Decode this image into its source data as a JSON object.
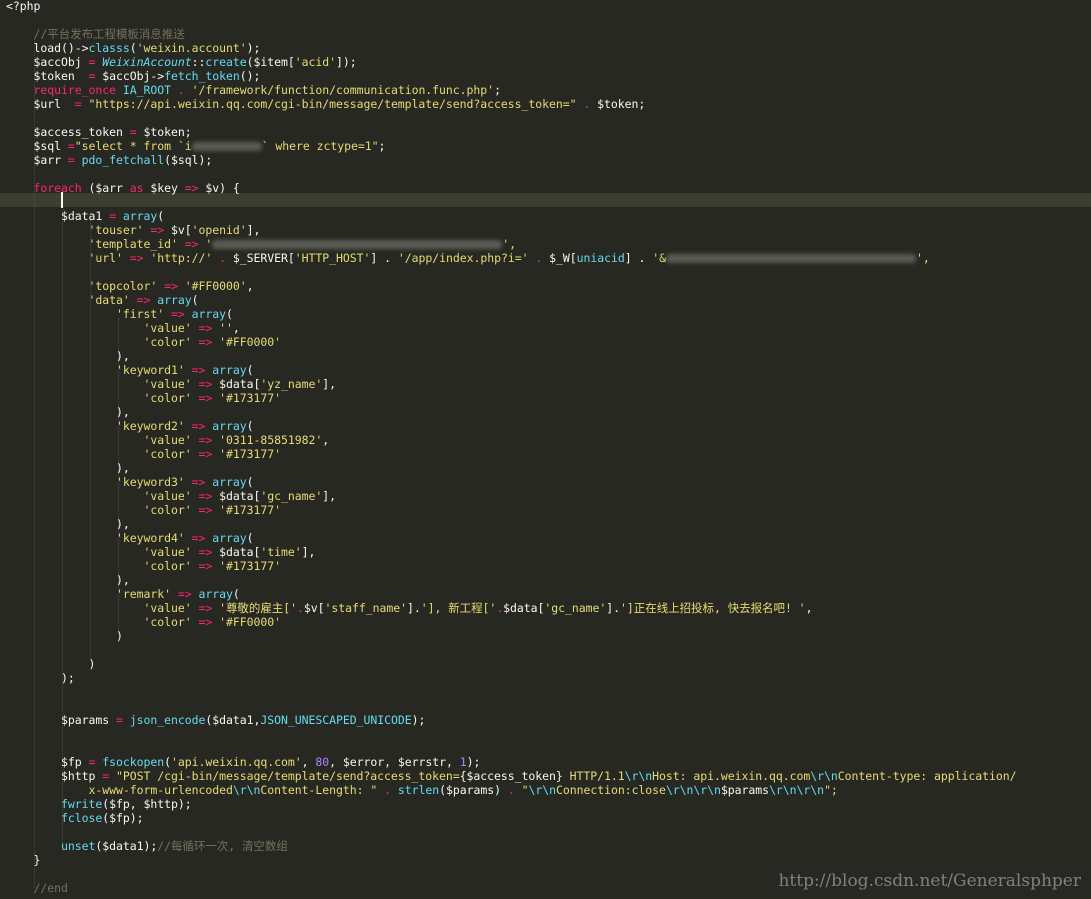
{
  "colors": {
    "background": "#272822",
    "keyword": "#f92672",
    "string": "#e6db74",
    "function": "#66d9ef",
    "comment": "#75715e",
    "number": "#ae81ff",
    "text": "#f8f8f2"
  },
  "watermark": "http://blog.csdn.net/Generalsphper",
  "code_lines": [
    {
      "tokens": [
        [
          "<?php",
          "plain"
        ]
      ]
    },
    {
      "tokens": []
    },
    {
      "tokens": [
        [
          "    //平台发布工程模板消息推送",
          "cm"
        ]
      ]
    },
    {
      "tokens": [
        [
          "    load()->",
          "plain"
        ],
        [
          "classs",
          "fn"
        ],
        [
          "(",
          "plain"
        ],
        [
          "'weixin.account'",
          "str"
        ],
        [
          ");",
          "plain"
        ]
      ]
    },
    {
      "tokens": [
        [
          "    $accObj ",
          "var"
        ],
        [
          "= ",
          "kw"
        ],
        [
          "WeixinAccount",
          "cls"
        ],
        [
          "::",
          "plain"
        ],
        [
          "create",
          "fn"
        ],
        [
          "($item[",
          "plain"
        ],
        [
          "'acid'",
          "str"
        ],
        [
          "]);",
          "plain"
        ]
      ]
    },
    {
      "tokens": [
        [
          "    $token  ",
          "var"
        ],
        [
          "= ",
          "kw"
        ],
        [
          "$accObj->",
          "plain"
        ],
        [
          "fetch_token",
          "fn"
        ],
        [
          "();",
          "plain"
        ]
      ]
    },
    {
      "tokens": [
        [
          "    require_once ",
          "kw"
        ],
        [
          "IA_ROOT ",
          "cst"
        ],
        [
          ". ",
          "kw"
        ],
        [
          "'/framework/function/communication.func.php'",
          "str"
        ],
        [
          ";",
          "plain"
        ]
      ]
    },
    {
      "tokens": [
        [
          "    $url  ",
          "var"
        ],
        [
          "= ",
          "kw"
        ],
        [
          "\"https://api.weixin.qq.com/cgi-bin/message/template/send?access_token=\"",
          "str"
        ],
        [
          " . ",
          "kw"
        ],
        [
          "$token;",
          "plain"
        ]
      ]
    },
    {
      "tokens": []
    },
    {
      "tokens": [
        [
          "    $access_token ",
          "var"
        ],
        [
          "= ",
          "kw"
        ],
        [
          "$token;",
          "plain"
        ]
      ]
    },
    {
      "tokens": [
        [
          "    $sql ",
          "var"
        ],
        [
          "=",
          "kw"
        ],
        [
          "\"select * from `i",
          "str"
        ],
        [
          "#blur:70",
          "blur"
        ],
        [
          "` where zctype=1\"",
          "str"
        ],
        [
          ";",
          "plain"
        ]
      ]
    },
    {
      "tokens": [
        [
          "    $arr ",
          "var"
        ],
        [
          "= ",
          "kw"
        ],
        [
          "pdo_fetchall",
          "fn"
        ],
        [
          "($sql);",
          "plain"
        ]
      ]
    },
    {
      "tokens": []
    },
    {
      "tokens": [
        [
          "    foreach ",
          "kw"
        ],
        [
          "($arr ",
          "plain"
        ],
        [
          "as ",
          "kw"
        ],
        [
          "$key ",
          "plain"
        ],
        [
          "=> ",
          "kw"
        ],
        [
          "$v) {",
          "plain"
        ]
      ]
    },
    {
      "tokens": []
    },
    {
      "tokens": [
        [
          "        $data1 ",
          "var"
        ],
        [
          "= ",
          "kw"
        ],
        [
          "array",
          "fn"
        ],
        [
          "(",
          "plain"
        ]
      ]
    },
    {
      "tokens": [
        [
          "            'touser'",
          "str"
        ],
        [
          " => ",
          "kw"
        ],
        [
          "$v[",
          "plain"
        ],
        [
          "'openid'",
          "str"
        ],
        [
          "],",
          "plain"
        ]
      ]
    },
    {
      "tokens": [
        [
          "            'template_id'",
          "str"
        ],
        [
          " => ",
          "kw"
        ],
        [
          "'",
          "str"
        ],
        [
          "#blur:290",
          "blur"
        ],
        [
          "',",
          "str"
        ]
      ]
    },
    {
      "tokens": [
        [
          "            'url'",
          "str"
        ],
        [
          " => ",
          "kw"
        ],
        [
          "'http://'",
          "str"
        ],
        [
          " . ",
          "kw"
        ],
        [
          "$_SERVER[",
          "plain"
        ],
        [
          "'HTTP_HOST'",
          "str"
        ],
        [
          "] . ",
          "plain"
        ],
        [
          "'/app/index.php?i='",
          "str"
        ],
        [
          " . ",
          "kw"
        ],
        [
          "$_W[",
          "plain"
        ],
        [
          "uniacid",
          "fn"
        ],
        [
          "] . ",
          "plain"
        ],
        [
          "'&",
          "str"
        ],
        [
          "#blur:250",
          "blur"
        ],
        [
          "',",
          "str"
        ]
      ]
    },
    {
      "tokens": []
    },
    {
      "tokens": [
        [
          "            'topcolor'",
          "str"
        ],
        [
          " => ",
          "kw"
        ],
        [
          "'#FF0000'",
          "str"
        ],
        [
          ",",
          "plain"
        ]
      ]
    },
    {
      "tokens": [
        [
          "            'data'",
          "str"
        ],
        [
          " => ",
          "kw"
        ],
        [
          "array",
          "fn"
        ],
        [
          "(",
          "plain"
        ]
      ]
    },
    {
      "tokens": [
        [
          "                'first'",
          "str"
        ],
        [
          " => ",
          "kw"
        ],
        [
          "array",
          "fn"
        ],
        [
          "(",
          "plain"
        ]
      ]
    },
    {
      "tokens": [
        [
          "                    'value'",
          "str"
        ],
        [
          " => ",
          "kw"
        ],
        [
          "''",
          "str"
        ],
        [
          ",",
          "plain"
        ]
      ]
    },
    {
      "tokens": [
        [
          "                    'color'",
          "str"
        ],
        [
          " => ",
          "kw"
        ],
        [
          "'#FF0000'",
          "str"
        ]
      ]
    },
    {
      "tokens": [
        [
          "                ),",
          "plain"
        ]
      ]
    },
    {
      "tokens": [
        [
          "                'keyword1'",
          "str"
        ],
        [
          " => ",
          "kw"
        ],
        [
          "array",
          "fn"
        ],
        [
          "(",
          "plain"
        ]
      ]
    },
    {
      "tokens": [
        [
          "                    'value'",
          "str"
        ],
        [
          " => ",
          "kw"
        ],
        [
          "$data[",
          "plain"
        ],
        [
          "'yz_name'",
          "str"
        ],
        [
          "],",
          "plain"
        ]
      ]
    },
    {
      "tokens": [
        [
          "                    'color'",
          "str"
        ],
        [
          " => ",
          "kw"
        ],
        [
          "'#173177'",
          "str"
        ]
      ]
    },
    {
      "tokens": [
        [
          "                ),",
          "plain"
        ]
      ]
    },
    {
      "tokens": [
        [
          "                'keyword2'",
          "str"
        ],
        [
          " => ",
          "kw"
        ],
        [
          "array",
          "fn"
        ],
        [
          "(",
          "plain"
        ]
      ]
    },
    {
      "tokens": [
        [
          "                    'value'",
          "str"
        ],
        [
          " => ",
          "kw"
        ],
        [
          "'0311-85851982'",
          "str"
        ],
        [
          ",",
          "plain"
        ]
      ]
    },
    {
      "tokens": [
        [
          "                    'color'",
          "str"
        ],
        [
          " => ",
          "kw"
        ],
        [
          "'#173177'",
          "str"
        ]
      ]
    },
    {
      "tokens": [
        [
          "                ),",
          "plain"
        ]
      ]
    },
    {
      "tokens": [
        [
          "                'keyword3'",
          "str"
        ],
        [
          " => ",
          "kw"
        ],
        [
          "array",
          "fn"
        ],
        [
          "(",
          "plain"
        ]
      ]
    },
    {
      "tokens": [
        [
          "                    'value'",
          "str"
        ],
        [
          " => ",
          "kw"
        ],
        [
          "$data[",
          "plain"
        ],
        [
          "'gc_name'",
          "str"
        ],
        [
          "],",
          "plain"
        ]
      ]
    },
    {
      "tokens": [
        [
          "                    'color'",
          "str"
        ],
        [
          " => ",
          "kw"
        ],
        [
          "'#173177'",
          "str"
        ]
      ]
    },
    {
      "tokens": [
        [
          "                ),",
          "plain"
        ]
      ]
    },
    {
      "tokens": [
        [
          "                'keyword4'",
          "str"
        ],
        [
          " => ",
          "kw"
        ],
        [
          "array",
          "fn"
        ],
        [
          "(",
          "plain"
        ]
      ]
    },
    {
      "tokens": [
        [
          "                    'value'",
          "str"
        ],
        [
          " => ",
          "kw"
        ],
        [
          "$data[",
          "plain"
        ],
        [
          "'time'",
          "str"
        ],
        [
          "],",
          "plain"
        ]
      ]
    },
    {
      "tokens": [
        [
          "                    'color'",
          "str"
        ],
        [
          " => ",
          "kw"
        ],
        [
          "'#173177'",
          "str"
        ]
      ]
    },
    {
      "tokens": [
        [
          "                ),",
          "plain"
        ]
      ]
    },
    {
      "tokens": [
        [
          "                'remark'",
          "str"
        ],
        [
          " => ",
          "kw"
        ],
        [
          "array",
          "fn"
        ],
        [
          "(",
          "plain"
        ]
      ]
    },
    {
      "tokens": [
        [
          "                    'value'",
          "str"
        ],
        [
          " => ",
          "kw"
        ],
        [
          "'尊敬的雇主['",
          "str"
        ],
        [
          ".",
          "kw"
        ],
        [
          "$v[",
          "plain"
        ],
        [
          "'staff_name'",
          "str"
        ],
        [
          "].",
          "plain"
        ],
        [
          "'], 新工程['",
          "str"
        ],
        [
          ".",
          "kw"
        ],
        [
          "$data[",
          "plain"
        ],
        [
          "'gc_name'",
          "str"
        ],
        [
          "].",
          "plain"
        ],
        [
          "']正在线上招投标, 快去报名吧! '",
          "str"
        ],
        [
          ",",
          "plain"
        ]
      ]
    },
    {
      "tokens": [
        [
          "                    'color'",
          "str"
        ],
        [
          " => ",
          "kw"
        ],
        [
          "'#FF0000'",
          "str"
        ]
      ]
    },
    {
      "tokens": [
        [
          "                )",
          "plain"
        ]
      ]
    },
    {
      "tokens": []
    },
    {
      "tokens": [
        [
          "            )",
          "plain"
        ]
      ]
    },
    {
      "tokens": [
        [
          "        );",
          "plain"
        ]
      ]
    },
    {
      "tokens": []
    },
    {
      "tokens": []
    },
    {
      "tokens": [
        [
          "        $params ",
          "var"
        ],
        [
          "= ",
          "kw"
        ],
        [
          "json_encode",
          "fn"
        ],
        [
          "($data1,",
          "plain"
        ],
        [
          "JSON_UNESCAPED_UNICODE",
          "cst"
        ],
        [
          ");",
          "plain"
        ]
      ]
    },
    {
      "tokens": []
    },
    {
      "tokens": []
    },
    {
      "tokens": [
        [
          "        $fp ",
          "var"
        ],
        [
          "= ",
          "kw"
        ],
        [
          "fsockopen",
          "fn"
        ],
        [
          "(",
          "plain"
        ],
        [
          "'api.weixin.qq.com'",
          "str"
        ],
        [
          ", ",
          "plain"
        ],
        [
          "80",
          "num"
        ],
        [
          ", $error, $errstr, ",
          "plain"
        ],
        [
          "1",
          "num"
        ],
        [
          ");",
          "plain"
        ]
      ]
    },
    {
      "tokens": [
        [
          "        $http ",
          "var"
        ],
        [
          "= ",
          "kw"
        ],
        [
          "\"POST /cgi-bin/message/template/send?access_token=",
          "str"
        ],
        [
          "{$access_token}",
          "plain"
        ],
        [
          " HTTP/1.1",
          "str"
        ],
        [
          "\\r\\n",
          "fn"
        ],
        [
          "Host: api.weixin.qq.com",
          "str"
        ],
        [
          "\\r\\n",
          "fn"
        ],
        [
          "Content-type: application/",
          "str"
        ]
      ]
    },
    {
      "tokens": [
        [
          "            x-www-form-urlencoded",
          "str"
        ],
        [
          "\\r\\n",
          "fn"
        ],
        [
          "Content-Length: \"",
          "str"
        ],
        [
          " . ",
          "kw"
        ],
        [
          "strlen",
          "fn"
        ],
        [
          "($params) ",
          "plain"
        ],
        [
          ". ",
          "kw"
        ],
        [
          "\"",
          "str"
        ],
        [
          "\\r\\n",
          "fn"
        ],
        [
          "Connection:close",
          "str"
        ],
        [
          "\\r\\n\\r\\n",
          "fn"
        ],
        [
          "$params",
          "plain"
        ],
        [
          "\\r\\n\\r\\n",
          "fn"
        ],
        [
          "\";",
          "str"
        ]
      ]
    },
    {
      "tokens": [
        [
          "        fwrite",
          "fn"
        ],
        [
          "($fp, $http);",
          "plain"
        ]
      ]
    },
    {
      "tokens": [
        [
          "        fclose",
          "fn"
        ],
        [
          "($fp);",
          "plain"
        ]
      ]
    },
    {
      "tokens": []
    },
    {
      "tokens": [
        [
          "        unset",
          "fn"
        ],
        [
          "($data1);",
          "plain"
        ],
        [
          "//每循环一次, 清空数组",
          "cm"
        ]
      ]
    },
    {
      "tokens": [
        [
          "    }",
          "plain"
        ]
      ]
    },
    {
      "tokens": []
    },
    {
      "tokens": [
        [
          "    //end",
          "cm"
        ]
      ]
    }
  ]
}
